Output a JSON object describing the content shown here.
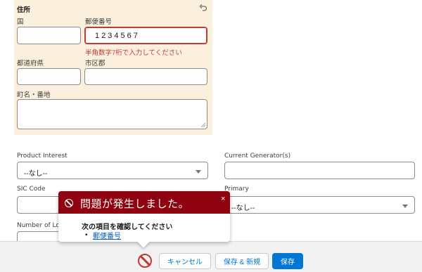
{
  "address": {
    "section_title": "住所",
    "country_label": "国",
    "postal_label": "郵便番号",
    "postal_value": "1234567",
    "postal_error": "半角数字7桁で入力してください",
    "prefecture_label": "都道府県",
    "city_label": "市区郡",
    "street_label": "町名・番地"
  },
  "fields": {
    "product_interest_label": "Product Interest",
    "product_interest_value": "--なし--",
    "current_generators_label": "Current Generator(s)",
    "sic_code_label": "SIC Code",
    "primary_label": "Primary",
    "primary_value": "--なし--",
    "number_of_locations_label": "Number of Lo"
  },
  "error_popover": {
    "title": "問題が発生しました。",
    "close_glyph": "×",
    "body_title": "次の項目を確認してください",
    "items": [
      "郵便番号"
    ]
  },
  "footer": {
    "cancel_label": "キャンセル",
    "save_new_label": "保存 & 新規",
    "save_label": "保存"
  },
  "colors": {
    "panel_bg": "#faf0dd",
    "error": "#c23934",
    "popover_header": "#8e030f",
    "brand": "#0176d3"
  }
}
